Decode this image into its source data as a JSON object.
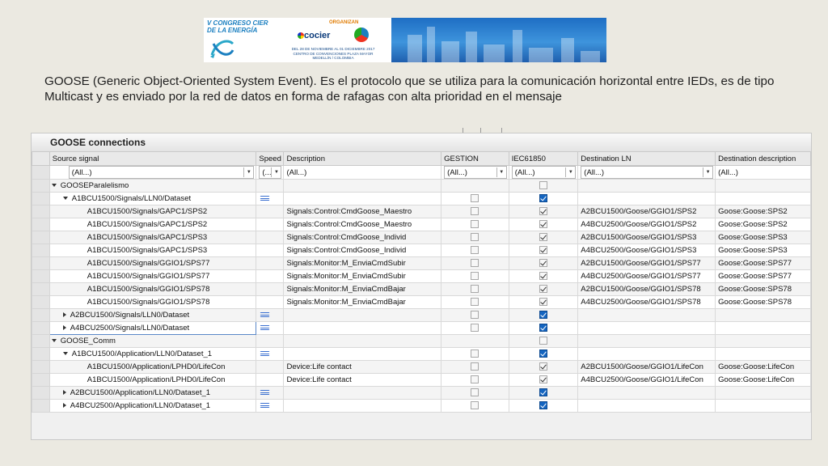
{
  "banner": {
    "congress_line1": "V CONGRESO CIER",
    "congress_line2": "DE LA ENERGÍA",
    "organizan": "ORGANIZAN",
    "cocier": "cocier",
    "cier": "cier",
    "date": "DEL 28 DE NOVIEMBRE AL 01 DICIEMBRE 2017",
    "venue": "CENTRO DE CONVENCIONES PLAZA MAYOR",
    "city": "MEDELLÍN / COLOMBIA"
  },
  "description_text": "GOOSE (Generic Object-Oriented System Event). Es el protocolo que se utiliza para la comunicación horizontal entre IEDs, es de tipo Multicast y es enviado por la red de datos en forma de rafagas con alta prioridad en el mensaje",
  "panel": {
    "title": "GOOSE connections",
    "columns": [
      "Source signal",
      "Speed",
      "Description",
      "GESTION",
      "IEC61850",
      "Destination LN",
      "Destination description"
    ],
    "filters": {
      "source": "(All...)",
      "speed": "(...",
      "description": "(All...)",
      "gestion": "(All...)",
      "iec": "(All...)",
      "dest_ln": "(All...)",
      "dest_desc": "(All...)"
    },
    "rows": [
      {
        "source": "GOOSEParalelismo"
      },
      {
        "source": "A1BCU1500/Signals/LLN0/Dataset"
      },
      {
        "source": "A1BCU1500/Signals/GAPC1/SPS2",
        "description": "Signals:Control:CmdGoose_Maestro",
        "dest_ln": "A2BCU1500/Goose/GGIO1/SPS2",
        "dest_desc": "Goose:Goose:SPS2"
      },
      {
        "source": "A1BCU1500/Signals/GAPC1/SPS2",
        "description": "Signals:Control:CmdGoose_Maestro",
        "dest_ln": "A4BCU2500/Goose/GGIO1/SPS2",
        "dest_desc": "Goose:Goose:SPS2"
      },
      {
        "source": "A1BCU1500/Signals/GAPC1/SPS3",
        "description": "Signals:Control:CmdGoose_Individ",
        "dest_ln": "A2BCU1500/Goose/GGIO1/SPS3",
        "dest_desc": "Goose:Goose:SPS3"
      },
      {
        "source": "A1BCU1500/Signals/GAPC1/SPS3",
        "description": "Signals:Control:CmdGoose_Individ",
        "dest_ln": "A4BCU2500/Goose/GGIO1/SPS3",
        "dest_desc": "Goose:Goose:SPS3"
      },
      {
        "source": "A1BCU1500/Signals/GGIO1/SPS77",
        "description": "Signals:Monitor:M_EnviaCmdSubir",
        "dest_ln": "A2BCU1500/Goose/GGIO1/SPS77",
        "dest_desc": "Goose:Goose:SPS77"
      },
      {
        "source": "A1BCU1500/Signals/GGIO1/SPS77",
        "description": "Signals:Monitor:M_EnviaCmdSubir",
        "dest_ln": "A4BCU2500/Goose/GGIO1/SPS77",
        "dest_desc": "Goose:Goose:SPS77"
      },
      {
        "source": "A1BCU1500/Signals/GGIO1/SPS78",
        "description": "Signals:Monitor:M_EnviaCmdBajar",
        "dest_ln": "A2BCU1500/Goose/GGIO1/SPS78",
        "dest_desc": "Goose:Goose:SPS78"
      },
      {
        "source": "A1BCU1500/Signals/GGIO1/SPS78",
        "description": "Signals:Monitor:M_EnviaCmdBajar",
        "dest_ln": "A4BCU2500/Goose/GGIO1/SPS78",
        "dest_desc": "Goose:Goose:SPS78"
      },
      {
        "source": "A2BCU1500/Signals/LLN0/Dataset"
      },
      {
        "source": "A4BCU2500/Signals/LLN0/Dataset"
      },
      {
        "source": "GOOSE_Comm"
      },
      {
        "source": "A1BCU1500/Application/LLN0/Dataset_1"
      },
      {
        "source": "A1BCU1500/Application/LPHD0/LifeCon",
        "description": "Device:Life contact",
        "dest_ln": "A2BCU1500/Goose/GGIO1/LifeCon",
        "dest_desc": "Goose:Goose:LifeCon"
      },
      {
        "source": "A1BCU1500/Application/LPHD0/LifeCon",
        "description": "Device:Life contact",
        "dest_ln": "A4BCU2500/Goose/GGIO1/LifeCon",
        "dest_desc": "Goose:Goose:LifeCon"
      },
      {
        "source": "A2BCU1500/Application/LLN0/Dataset_1"
      },
      {
        "source": "A4BCU2500/Application/LLN0/Dataset_1"
      }
    ]
  },
  "colors": {
    "checked_blue": "#1565c0",
    "speed_icon": "#3a6fd0"
  }
}
